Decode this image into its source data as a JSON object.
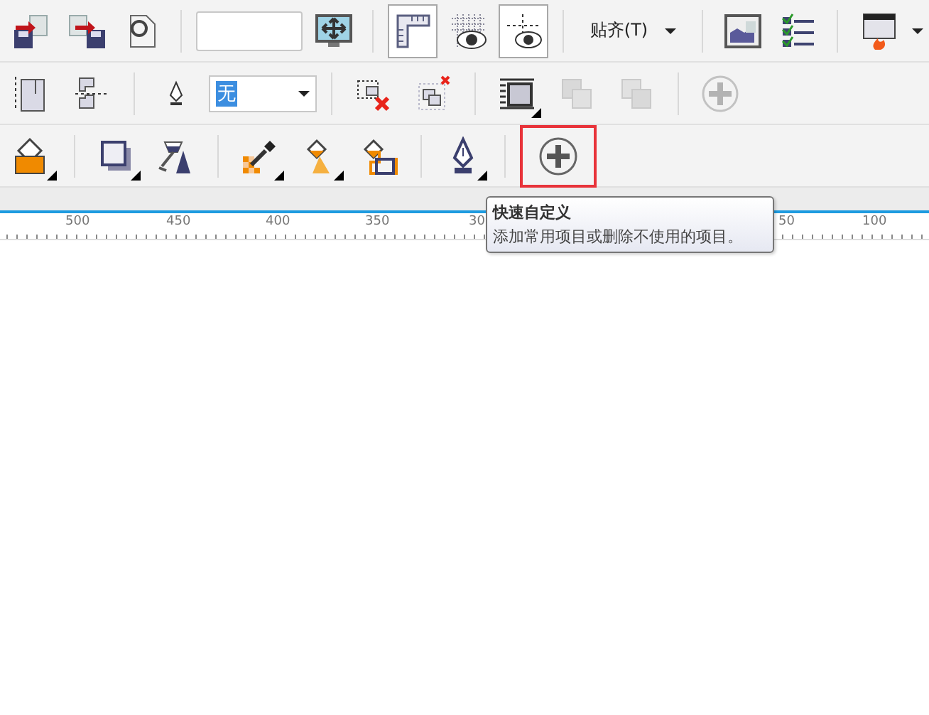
{
  "toolbars": [
    {
      "items": [
        {
          "kind": "button",
          "pressed": false,
          "disabled": false,
          "corner_arrow": false,
          "caret": false,
          "highlighted": false
        },
        {
          "kind": "button",
          "pressed": false,
          "disabled": false,
          "corner_arrow": false,
          "caret": false,
          "highlighted": false
        },
        {
          "kind": "button",
          "pressed": false,
          "disabled": false,
          "corner_arrow": false,
          "caret": false,
          "highlighted": false
        },
        {
          "kind": "separator"
        },
        {
          "kind": "field"
        },
        {
          "kind": "button",
          "pressed": false,
          "disabled": false,
          "corner_arrow": false,
          "caret": false,
          "highlighted": false
        },
        {
          "kind": "separator"
        },
        {
          "kind": "button",
          "pressed": true,
          "disabled": false,
          "corner_arrow": false,
          "caret": false,
          "highlighted": false
        },
        {
          "kind": "button",
          "pressed": false,
          "disabled": false,
          "corner_arrow": false,
          "caret": false,
          "highlighted": false
        },
        {
          "kind": "button",
          "pressed": true,
          "disabled": false,
          "corner_arrow": false,
          "caret": false,
          "highlighted": false
        },
        {
          "kind": "separator"
        },
        {
          "kind": "dropdown",
          "label": "贴齐(T)"
        },
        {
          "kind": "separator"
        },
        {
          "kind": "button",
          "pressed": false,
          "disabled": false,
          "corner_arrow": false,
          "caret": false,
          "highlighted": false
        },
        {
          "kind": "button",
          "pressed": false,
          "disabled": false,
          "corner_arrow": false,
          "caret": false,
          "highlighted": false
        },
        {
          "kind": "separator"
        },
        {
          "kind": "button",
          "pressed": false,
          "disabled": false,
          "corner_arrow": false,
          "caret": true,
          "highlighted": false
        }
      ]
    },
    {
      "items": [
        {
          "kind": "button",
          "pressed": false,
          "disabled": false,
          "corner_arrow": false,
          "caret": false,
          "highlighted": false
        },
        {
          "kind": "button",
          "pressed": false,
          "disabled": false,
          "corner_arrow": false,
          "caret": false,
          "highlighted": false
        },
        {
          "kind": "separator"
        },
        {
          "kind": "button",
          "pressed": false,
          "disabled": false,
          "corner_arrow": false,
          "caret": false,
          "highlighted": false
        },
        {
          "kind": "combobox",
          "value": "无"
        },
        {
          "kind": "separator"
        },
        {
          "kind": "button",
          "pressed": false,
          "disabled": false,
          "corner_arrow": false,
          "caret": false,
          "highlighted": false
        },
        {
          "kind": "button",
          "pressed": false,
          "disabled": false,
          "corner_arrow": false,
          "caret": false,
          "highlighted": false
        },
        {
          "kind": "separator"
        },
        {
          "kind": "button",
          "pressed": false,
          "disabled": false,
          "corner_arrow": true,
          "caret": false,
          "highlighted": false
        },
        {
          "kind": "button",
          "pressed": false,
          "disabled": true,
          "corner_arrow": false,
          "caret": false,
          "highlighted": false
        },
        {
          "kind": "button",
          "pressed": false,
          "disabled": true,
          "corner_arrow": false,
          "caret": false,
          "highlighted": false
        },
        {
          "kind": "separator"
        },
        {
          "kind": "button",
          "pressed": false,
          "disabled": true,
          "corner_arrow": false,
          "caret": false,
          "highlighted": false
        }
      ]
    },
    {
      "items": [
        {
          "kind": "button",
          "pressed": false,
          "disabled": false,
          "corner_arrow": true,
          "caret": false,
          "highlighted": false
        },
        {
          "kind": "separator"
        },
        {
          "kind": "button",
          "pressed": false,
          "disabled": false,
          "corner_arrow": true,
          "caret": false,
          "highlighted": false
        },
        {
          "kind": "button",
          "pressed": false,
          "disabled": false,
          "corner_arrow": false,
          "caret": false,
          "highlighted": false
        },
        {
          "kind": "separator"
        },
        {
          "kind": "button",
          "pressed": false,
          "disabled": false,
          "corner_arrow": true,
          "caret": false,
          "highlighted": false
        },
        {
          "kind": "button",
          "pressed": false,
          "disabled": false,
          "corner_arrow": true,
          "caret": false,
          "highlighted": false
        },
        {
          "kind": "button",
          "pressed": false,
          "disabled": false,
          "corner_arrow": false,
          "caret": false,
          "highlighted": false
        },
        {
          "kind": "separator"
        },
        {
          "kind": "button",
          "pressed": false,
          "disabled": false,
          "corner_arrow": true,
          "caret": false,
          "highlighted": false
        },
        {
          "kind": "separator"
        },
        {
          "kind": "button",
          "pressed": false,
          "disabled": false,
          "corner_arrow": false,
          "caret": false,
          "highlighted": true
        }
      ]
    }
  ],
  "ruler": {
    "labels": [
      "500",
      "450",
      "400",
      "350",
      "30",
      "50",
      "100"
    ]
  },
  "tooltip": {
    "title": "快速自定义",
    "text": "添加常用项目或删除不使用的项目。"
  }
}
